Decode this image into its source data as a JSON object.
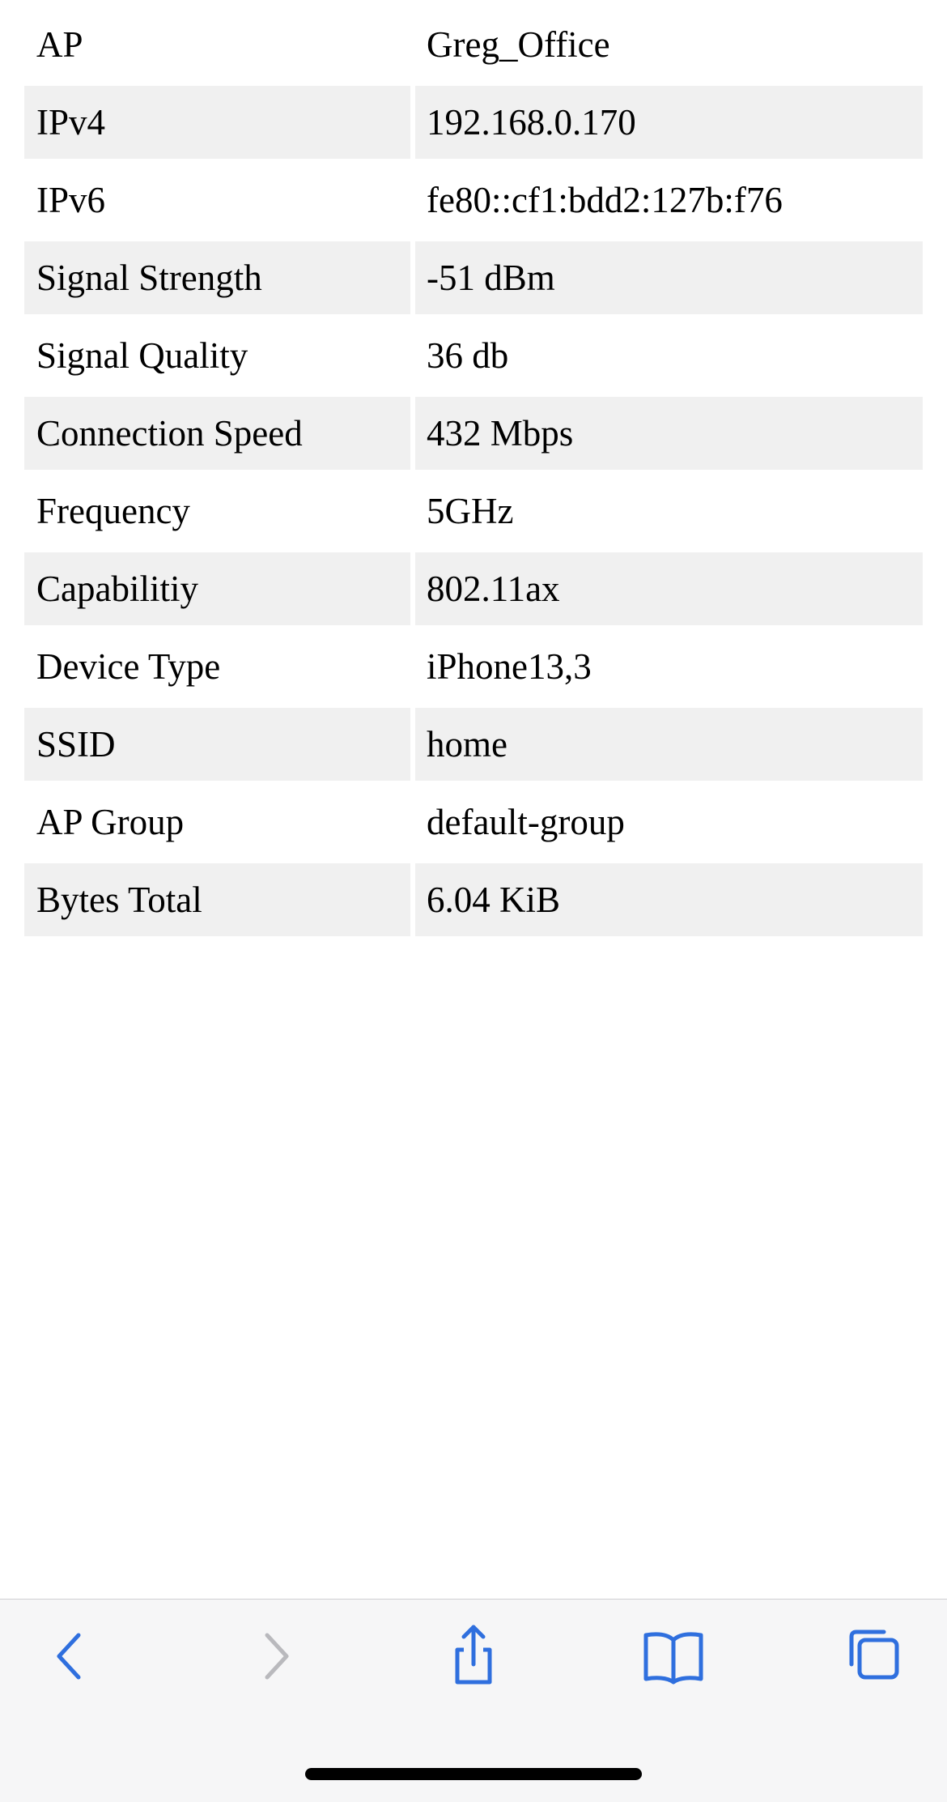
{
  "rows": [
    {
      "label": "AP",
      "value": "Greg_Office"
    },
    {
      "label": "IPv4",
      "value": "192.168.0.170"
    },
    {
      "label": "IPv6",
      "value": "fe80::cf1:bdd2:127b:f76"
    },
    {
      "label": "Signal Strength",
      "value": "-51 dBm"
    },
    {
      "label": "Signal Quality",
      "value": "36 db"
    },
    {
      "label": "Connection Speed",
      "value": "432 Mbps"
    },
    {
      "label": "Frequency",
      "value": "5GHz"
    },
    {
      "label": "Capabilitiy",
      "value": "802.11ax"
    },
    {
      "label": "Device Type",
      "value": "iPhone13,3"
    },
    {
      "label": "SSID",
      "value": "home"
    },
    {
      "label": "AP Group",
      "value": "default-group"
    },
    {
      "label": "Bytes Total",
      "value": "6.04 KiB"
    }
  ],
  "toolbar": {
    "items": [
      {
        "icon": "chevron-left-icon",
        "action": "back",
        "enabled": true
      },
      {
        "icon": "chevron-right-icon",
        "action": "forward",
        "enabled": false
      },
      {
        "icon": "share-icon",
        "action": "share",
        "enabled": true
      },
      {
        "icon": "book-icon",
        "action": "bookmarks",
        "enabled": true
      },
      {
        "icon": "tabs-icon",
        "action": "tabs",
        "enabled": true
      }
    ]
  },
  "colors": {
    "accent": "#2f6fde",
    "disabled": "#b9b9bd",
    "row_shade": "#f0f0f0",
    "toolbar_bg": "#f6f6f7"
  }
}
